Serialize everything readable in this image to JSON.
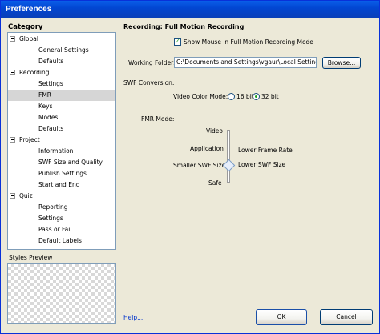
{
  "window": {
    "title": "Preferences"
  },
  "sidebar": {
    "category_label": "Category",
    "tree": [
      {
        "label": "Global",
        "level": 0,
        "expanded": true
      },
      {
        "label": "General Settings",
        "level": 1
      },
      {
        "label": "Defaults",
        "level": 1
      },
      {
        "label": "Recording",
        "level": 0,
        "expanded": true
      },
      {
        "label": "Settings",
        "level": 1
      },
      {
        "label": "FMR",
        "level": 1,
        "selected": true
      },
      {
        "label": "Keys",
        "level": 1
      },
      {
        "label": "Modes",
        "level": 1
      },
      {
        "label": "Defaults",
        "level": 1
      },
      {
        "label": "Project",
        "level": 0,
        "expanded": true
      },
      {
        "label": "Information",
        "level": 1
      },
      {
        "label": "SWF Size and Quality",
        "level": 1
      },
      {
        "label": "Publish Settings",
        "level": 1
      },
      {
        "label": "Start and End",
        "level": 1
      },
      {
        "label": "Quiz",
        "level": 0,
        "expanded": true
      },
      {
        "label": "Reporting",
        "level": 1
      },
      {
        "label": "Settings",
        "level": 1
      },
      {
        "label": "Pass or Fail",
        "level": 1
      },
      {
        "label": "Default Labels",
        "level": 1
      }
    ],
    "styles_preview_label": "Styles Preview"
  },
  "main": {
    "section_title": "Recording: Full Motion Recording",
    "show_mouse": {
      "label": "Show Mouse in Full Motion Recording Mode",
      "checked": true
    },
    "working_folder": {
      "label": "Working Folder:",
      "value": "C:\\Documents and Settings\\vgaur\\Local Settings",
      "browse_label": "Browse..."
    },
    "swf_conversion": {
      "label": "SWF Conversion:",
      "video_color_mode_label": "Video Color Mode:",
      "options": [
        "16 bit",
        "32 bit"
      ],
      "selected": "32 bit"
    },
    "fmr_mode": {
      "label": "FMR Mode:",
      "left_labels": [
        "Video",
        "Application",
        "Smaller SWF Size",
        "Safe"
      ],
      "right_labels": [
        "Lower Frame Rate",
        "Lower SWF Size"
      ],
      "slider_level": "Smaller SWF Size"
    }
  },
  "footer": {
    "help_label": "Help...",
    "ok_label": "OK",
    "cancel_label": "Cancel"
  }
}
